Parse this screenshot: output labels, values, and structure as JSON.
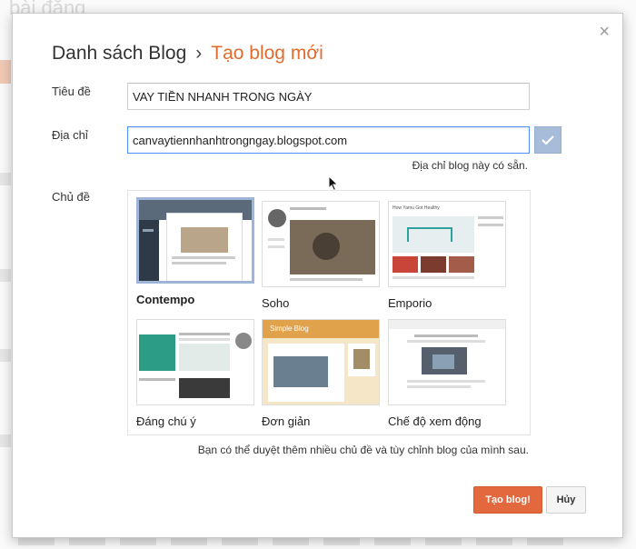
{
  "background": {
    "title_fragment": "bài đăng"
  },
  "dialog": {
    "breadcrumb_parent": "Danh sách Blog",
    "breadcrumb_separator": "›",
    "breadcrumb_current": "Tạo blog mới",
    "close_symbol": "×",
    "title_label": "Tiêu đề",
    "title_value": "VAY TIỀN NHANH TRONG NGÀY",
    "address_label": "Địa chỉ",
    "address_value": "canvaytiennhanhtrongngay.blogspot.com",
    "address_status": "Địa chỉ blog này có sẵn.",
    "theme_label": "Chủ đề",
    "themes": [
      {
        "name": "Contempo",
        "selected": true
      },
      {
        "name": "Soho",
        "selected": false
      },
      {
        "name": "Emporio",
        "selected": false
      },
      {
        "name": "Đáng chú ý",
        "selected": false
      },
      {
        "name": "Đơn giản",
        "selected": false
      },
      {
        "name": "Chế độ xem động",
        "selected": false
      }
    ],
    "thumb_texts": {
      "emporio_header": "How Yamu Got Healthy",
      "simple_header": "Simple Blog"
    },
    "footer_note": "Bạn có thể duyệt thêm nhiều chủ đề và tùy chỉnh blog của mình sau.",
    "create_button": "Tạo blog!",
    "cancel_button": "Hủy"
  },
  "colors": {
    "accent_orange": "#e36b2c",
    "create_button": "#e3683e",
    "focus_blue": "#4d90fe",
    "check_button": "#a7bcd9"
  },
  "icons": {
    "close": "close-icon",
    "check": "check-icon",
    "cursor": "mouse-pointer-icon"
  }
}
